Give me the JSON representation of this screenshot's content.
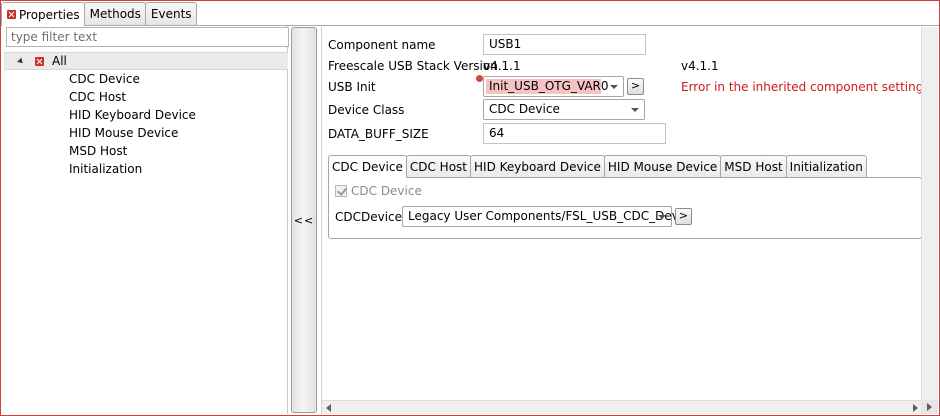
{
  "view_tabs": [
    {
      "label": "Properties",
      "icon": "error-x-icon",
      "active": true
    },
    {
      "label": "Methods",
      "active": false
    },
    {
      "label": "Events",
      "active": false
    }
  ],
  "filter": {
    "placeholder": "type filter text",
    "value": ""
  },
  "tree": {
    "root": {
      "label": "All",
      "icon": "error-x-icon",
      "expanded": true
    },
    "children": [
      "CDC Device",
      "CDC Host",
      "HID Keyboard Device",
      "HID Mouse Device",
      "MSD Host",
      "Initialization"
    ]
  },
  "splitter": {
    "collapse_label": "<<"
  },
  "properties": {
    "component_name": {
      "label": "Component name",
      "value": "USB1"
    },
    "stack_version": {
      "label": "Freescale USB Stack Version",
      "value": "v4.1.1",
      "value2": "v4.1.1"
    },
    "usb_init": {
      "label": "USB Init",
      "value": "Init_USB_OTG_VAR0",
      "button": ">",
      "error": "Error in the inherited component settings"
    },
    "device_class": {
      "label": "Device Class",
      "value": "CDC Device"
    },
    "data_buff_size": {
      "label": "DATA_BUFF_SIZE",
      "value": "64"
    }
  },
  "inner_tabs": [
    {
      "label": "CDC Device",
      "active": true
    },
    {
      "label": "CDC Host",
      "active": false
    },
    {
      "label": "HID Keyboard Device",
      "active": false
    },
    {
      "label": "HID Mouse Device",
      "active": false
    },
    {
      "label": "MSD Host",
      "active": false
    },
    {
      "label": "Initialization",
      "active": false
    }
  ],
  "cdc_device": {
    "checkbox_label": "CDC Device",
    "checked": true,
    "field_label": "CDCDevice",
    "field_value": "Legacy User Components/FSL_USB_CDC_Devic",
    "button": ">"
  },
  "colors": {
    "error": "#d11b1b",
    "error_bg": "#f6c3c3",
    "error_icon": "#c8312b"
  }
}
